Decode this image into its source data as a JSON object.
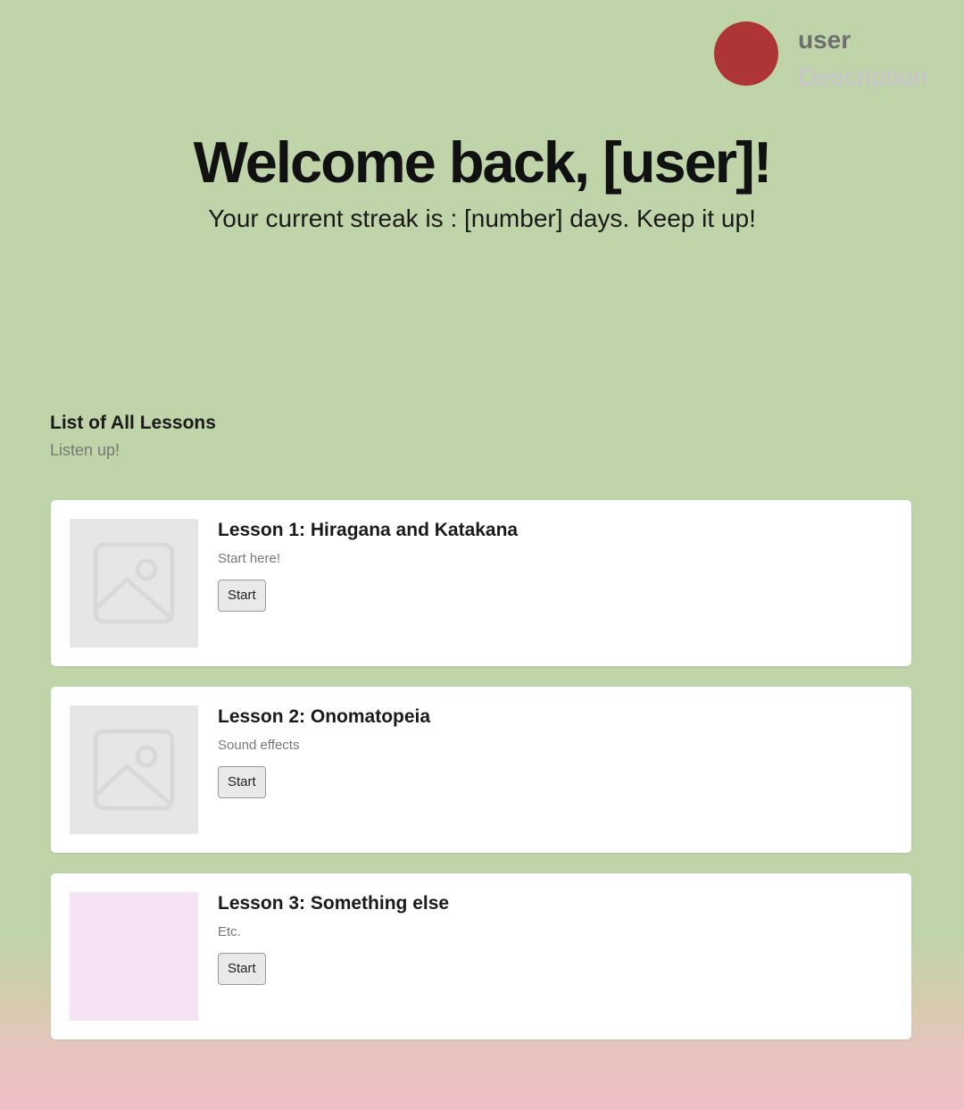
{
  "profile": {
    "name": "user",
    "description": "Description",
    "avatar_color": "#ad3535"
  },
  "hero": {
    "title": "Welcome back, [user]!",
    "subtitle": "Your current streak is : [number] days. Keep it up!"
  },
  "lessons_section": {
    "title": "List of All Lessons",
    "subtitle": "Listen up!"
  },
  "lessons": [
    {
      "title": "Lesson 1: Hiragana and Katakana",
      "description": "Start here!",
      "button_label": "Start",
      "thumbnail": "image-placeholder-icon"
    },
    {
      "title": "Lesson 2: Onomatopeia",
      "description": "Sound effects",
      "button_label": "Start",
      "thumbnail": "image-placeholder-icon"
    },
    {
      "title": "Lesson 3: Something else",
      "description": "Etc.",
      "button_label": "Start",
      "thumbnail": "pink-block"
    }
  ],
  "colors": {
    "background_green": "#bfd4a9",
    "background_pink": "#f0bec8",
    "thumbnail_gray": "#e6e6e6",
    "thumbnail_pink": "#f5e2f5"
  }
}
